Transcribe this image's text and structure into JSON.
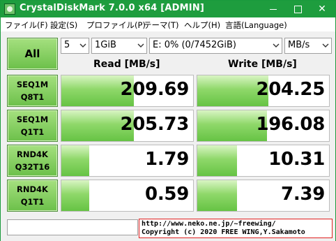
{
  "window": {
    "title": "CrystalDiskMark 7.0.0 x64 [ADMIN]"
  },
  "menu": [
    "ファイル(F)",
    "設定(S)",
    "プロファイル(P)",
    "テーマ(T)",
    "ヘルプ(H)",
    "言語(Language)"
  ],
  "toolbar": {
    "all_label": "All",
    "count": "5",
    "size": "1GiB",
    "drive": "E: 0% (0/7452GiB)",
    "unit": "MB/s"
  },
  "headers": {
    "read": "Read [MB/s]",
    "write": "Write [MB/s]"
  },
  "tests": [
    {
      "line1": "SEQ1M",
      "line2": "Q8T1",
      "read": "209.69",
      "write": "204.25",
      "read_level": 0.55,
      "write_level": 0.54
    },
    {
      "line1": "SEQ1M",
      "line2": "Q1T1",
      "read": "205.73",
      "write": "196.08",
      "read_level": 0.55,
      "write_level": 0.53
    },
    {
      "line1": "RND4K",
      "line2": "Q32T16",
      "read": "1.79",
      "write": "10.31",
      "read_level": 0.21,
      "write_level": 0.3
    },
    {
      "line1": "RND4K",
      "line2": "Q1T1",
      "read": "0.59",
      "write": "7.39",
      "read_level": 0.21,
      "write_level": 0.3
    }
  ],
  "footer": {
    "url": "http://www.neko.ne.jp/~freewing/",
    "copyright": "Copyright (c) 2020 FREE WING,Y.Sakamoto"
  },
  "colors": {
    "titlebar": "#1e9d3e",
    "bar_fill": "#66c344",
    "footer_border": "#e01f1f"
  }
}
